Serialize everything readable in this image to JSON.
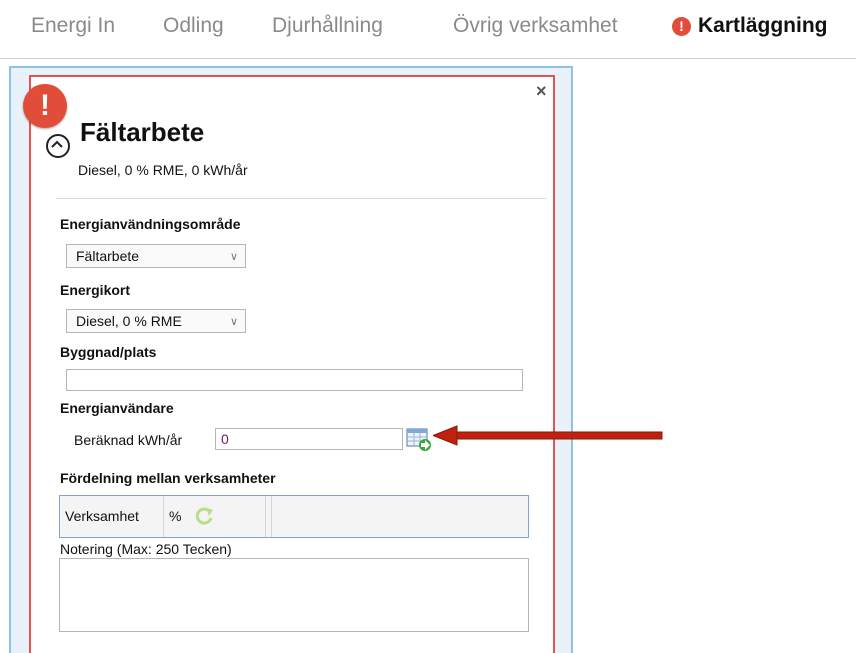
{
  "tabs": [
    {
      "label": "Energi In",
      "active": false
    },
    {
      "label": "Odling",
      "active": false
    },
    {
      "label": "Djurhållning",
      "active": false
    },
    {
      "label": "Övrig verksamhet",
      "active": false
    },
    {
      "label": "Kartläggning",
      "active": true,
      "has_warning": true
    }
  ],
  "panel": {
    "error_glyph": "!",
    "close_glyph": "×",
    "title": "Fältarbete",
    "summary": "Diesel, 0 % RME, 0 kWh/år",
    "area_label": "Energianvändningsområde",
    "area_value": "Fältarbete",
    "card_label": "Energikort",
    "card_value": "Diesel, 0 % RME",
    "building_label": "Byggnad/plats",
    "building_value": "",
    "user_label": "Energianvändare",
    "calc_label": "Beräknad kWh/år",
    "calc_value": "0",
    "distribution_label": "Fördelning mellan verksamheter",
    "grid_columns": [
      "Verksamhet",
      "%"
    ],
    "note_label": "Notering (Max: 250 Tecken)",
    "note_value": ""
  },
  "colors": {
    "error_red": "#e04e39",
    "panel_border": "#e25252",
    "window_border": "#8fc3e6",
    "arrow_red": "#c0210f"
  },
  "icons": [
    "warning-icon",
    "collapse-chevron-up-icon",
    "close-icon",
    "calculator-icon",
    "refresh-icon",
    "pointer-arrow-icon"
  ]
}
